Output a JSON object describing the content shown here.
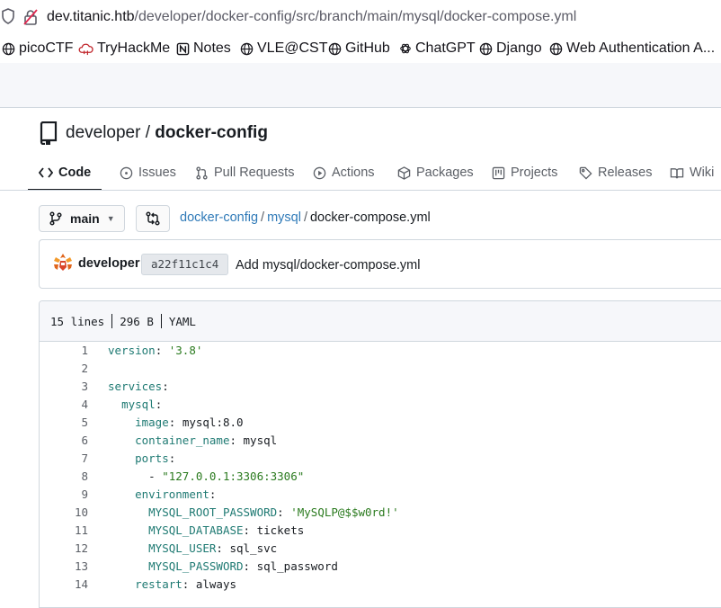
{
  "browser": {
    "url_host": "dev.titanic.htb",
    "url_path": "/developer/docker-config/src/branch/main/mysql/docker-compose.yml",
    "bookmarks": [
      "picoCTF",
      "TryHackMe",
      "Notes",
      "VLE@CST",
      "GitHub",
      "ChatGPT",
      "Django",
      "Web Authentication A..."
    ]
  },
  "repo": {
    "owner": "developer",
    "name": "docker-config"
  },
  "tabs": [
    "Code",
    "Issues",
    "Pull Requests",
    "Actions",
    "Packages",
    "Projects",
    "Releases",
    "Wiki"
  ],
  "branch": {
    "name": "main"
  },
  "breadcrumb": {
    "root": "docker-config",
    "dir": "mysql",
    "file": "docker-compose.yml"
  },
  "commit": {
    "author": "developer",
    "sha": "a22f11c1c4",
    "message": "Add mysql/docker-compose.yml"
  },
  "file": {
    "lines": "15 lines",
    "size": "296 B",
    "lang": "YAML"
  },
  "code_lines": [
    {
      "n": "1",
      "indent": "",
      "key": "version",
      "sep": ": ",
      "val": "'3.8'",
      "str": true
    },
    {
      "n": "2",
      "indent": "",
      "key": "",
      "sep": "",
      "val": "",
      "str": false
    },
    {
      "n": "3",
      "indent": "",
      "key": "services",
      "sep": ":",
      "val": "",
      "str": false
    },
    {
      "n": "4",
      "indent": "  ",
      "key": "mysql",
      "sep": ":",
      "val": "",
      "str": false
    },
    {
      "n": "5",
      "indent": "    ",
      "key": "image",
      "sep": ": ",
      "val": "mysql:8.0",
      "str": false
    },
    {
      "n": "6",
      "indent": "    ",
      "key": "container_name",
      "sep": ": ",
      "val": "mysql",
      "str": false
    },
    {
      "n": "7",
      "indent": "    ",
      "key": "ports",
      "sep": ":",
      "val": "",
      "str": false
    },
    {
      "n": "8",
      "indent": "      - ",
      "key": "",
      "sep": "",
      "val": "\"127.0.0.1:3306:3306\"",
      "str": true
    },
    {
      "n": "9",
      "indent": "    ",
      "key": "environment",
      "sep": ":",
      "val": "",
      "str": false
    },
    {
      "n": "10",
      "indent": "      ",
      "key": "MYSQL_ROOT_PASSWORD",
      "sep": ": ",
      "val": "'MySQLP@$$w0rd!'",
      "str": true
    },
    {
      "n": "11",
      "indent": "      ",
      "key": "MYSQL_DATABASE",
      "sep": ": ",
      "val": "tickets",
      "str": false
    },
    {
      "n": "12",
      "indent": "      ",
      "key": "MYSQL_USER",
      "sep": ": ",
      "val": "sql_svc",
      "str": false
    },
    {
      "n": "13",
      "indent": "      ",
      "key": "MYSQL_PASSWORD",
      "sep": ": ",
      "val": "sql_password",
      "str": false
    },
    {
      "n": "14",
      "indent": "    ",
      "key": "restart",
      "sep": ": ",
      "val": "always",
      "str": false
    }
  ]
}
